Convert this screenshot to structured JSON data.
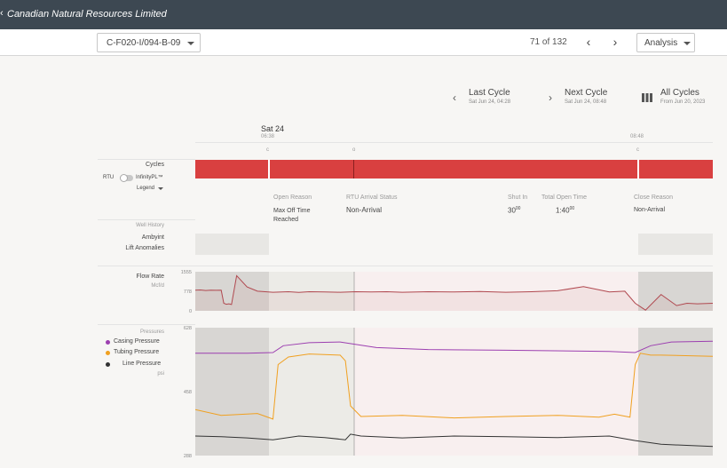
{
  "header": {
    "title": "Canadian Natural Resources Limited"
  },
  "toolbar": {
    "well_id": "C-F020-I/094-B-09",
    "counter": "71 of 132",
    "analysis_label": "Analysis"
  },
  "cycle_nav": {
    "last_label": "Last Cycle",
    "last_sub": "Sat Jun 24, 04:28",
    "next_label": "Next Cycle",
    "next_sub": "Sat Jun 24, 08:48",
    "all_label": "All Cycles",
    "all_sub": "From Jun 20, 2023"
  },
  "timeline": {
    "date_label": "Sat 24",
    "start_time": "06:38",
    "end_time": "08:48",
    "markers": [
      "c",
      "o",
      "c"
    ]
  },
  "left": {
    "cycles": "Cycles",
    "rtu": "RTU",
    "infinity": "InfinityPL™",
    "legend": "Legend",
    "well_history": "Well History",
    "ambyint": "Ambyint",
    "lift_anomalies": "Lift Anomalies",
    "flow_rate": "Flow Rate",
    "flow_unit": "Mcf/d",
    "pressures": "Pressures",
    "casing": "Casing Pressure",
    "tubing": "Tubing Pressure",
    "line": "Line Pressure",
    "pressure_unit": "psi"
  },
  "info": {
    "open_reason_label": "Open Reason",
    "open_reason": "Max Off Time Reached",
    "rtu_status_label": "RTU Arrival Status",
    "rtu_status": "Non-Arrival",
    "shut_in_label": "Shut In",
    "shut_in_main": "30",
    "shut_in_sup": "00",
    "total_open_label": "Total Open Time",
    "total_open_main": "1:40",
    "total_open_sup": "00",
    "close_reason_label": "Close Reason",
    "close_reason": "Non-Arrival"
  },
  "colors": {
    "header": "#3d4852",
    "cycle_red": "#d94040",
    "flow": "#b0484f",
    "casing": "#9c3fb0",
    "tubing": "#f0a020",
    "line": "#333333"
  },
  "chart_data": [
    {
      "type": "line",
      "title": "Flow Rate",
      "ylabel": "Mcf/d",
      "ylim": [
        0,
        1555
      ],
      "yticks": [
        0,
        778,
        1555
      ],
      "series": [
        {
          "name": "Flow Rate",
          "x": [
            0,
            1,
            2,
            3,
            4,
            5,
            5.5,
            6,
            6.5,
            7,
            8,
            10,
            12,
            15,
            18,
            20,
            22,
            25,
            28,
            31,
            34,
            37,
            40,
            45,
            50,
            55,
            60,
            65,
            70,
            75,
            80,
            83,
            85,
            87,
            90,
            93,
            95,
            97,
            100
          ],
          "y": [
            820,
            830,
            810,
            820,
            815,
            820,
            300,
            260,
            280,
            250,
            1400,
            950,
            780,
            740,
            760,
            730,
            760,
            750,
            740,
            760,
            750,
            760,
            740,
            760,
            750,
            770,
            740,
            760,
            800,
            960,
            750,
            780,
            300,
            30,
            650,
            210,
            300,
            280,
            300
          ]
        }
      ]
    },
    {
      "type": "line",
      "title": "Pressures",
      "ylabel": "psi",
      "ylim": [
        288,
        628
      ],
      "yticks": [
        288,
        458,
        628
      ],
      "series": [
        {
          "name": "Casing Pressure",
          "x": [
            0,
            10,
            15,
            17,
            22,
            28,
            35,
            45,
            60,
            80,
            85,
            88,
            92,
            100
          ],
          "y": [
            560,
            560,
            562,
            580,
            588,
            590,
            575,
            570,
            568,
            565,
            562,
            580,
            590,
            592
          ]
        },
        {
          "name": "Tubing Pressure",
          "x": [
            0,
            5,
            12,
            15,
            16,
            18,
            22,
            28,
            29,
            30,
            32,
            40,
            50,
            60,
            70,
            78,
            81,
            84,
            85,
            86,
            88,
            90,
            100
          ],
          "y": [
            410,
            395,
            400,
            385,
            530,
            550,
            558,
            555,
            540,
            420,
            392,
            395,
            388,
            392,
            395,
            390,
            398,
            390,
            530,
            560,
            555,
            555,
            552
          ]
        },
        {
          "name": "Line Pressure",
          "x": [
            0,
            5,
            10,
            15,
            20,
            25,
            29,
            30,
            32,
            40,
            50,
            60,
            70,
            80,
            85,
            90,
            100
          ],
          "y": [
            340,
            338,
            335,
            330,
            340,
            336,
            330,
            345,
            340,
            335,
            340,
            338,
            336,
            340,
            328,
            318,
            312
          ]
        }
      ]
    }
  ]
}
